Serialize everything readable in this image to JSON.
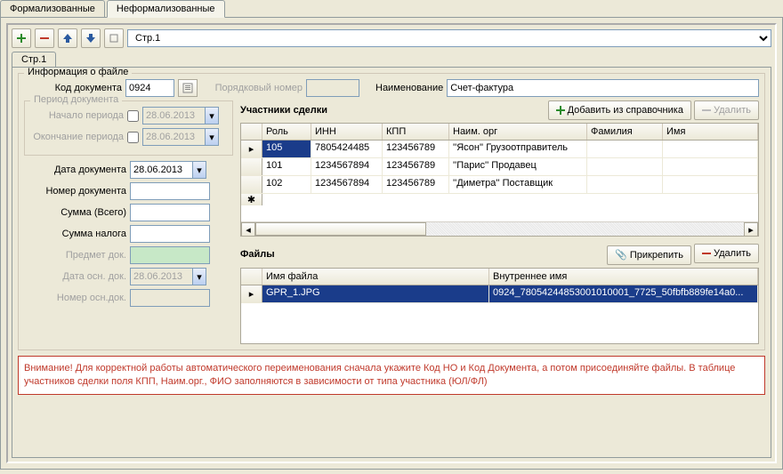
{
  "tabs": {
    "formal": "Формализованные",
    "informal": "Неформализованные"
  },
  "toolbar": {
    "page_label": "Стр.1"
  },
  "inner_tab": "Стр.1",
  "file_info_legend": "Информация о файле",
  "labels": {
    "doc_code": "Код документа",
    "ord_number": "Порядковый номер",
    "name": "Наименование",
    "period_legend": "Период документа",
    "period_start": "Начало периода",
    "period_end": "Окончание периода",
    "doc_date": "Дата документа",
    "doc_no": "Номер документа",
    "sum_total": "Сумма (Всего)",
    "sum_tax": "Сумма налога",
    "subject": "Предмет док.",
    "base_date": "Дата осн. док.",
    "base_no": "Номер осн.док."
  },
  "values": {
    "doc_code": "0924",
    "name": "Счет-фактура",
    "period_start": "28.06.2013",
    "period_end": "28.06.2013",
    "doc_date": "28.06.2013",
    "base_date": "28.06.2013"
  },
  "participants": {
    "title": "Участники сделки",
    "btn_add": "Добавить из справочника",
    "btn_del": "Удалить",
    "cols": {
      "role": "Роль",
      "inn": "ИНН",
      "kpp": "КПП",
      "org": "Наим. орг",
      "lastname": "Фамилия",
      "firstname": "Имя"
    },
    "rows": [
      {
        "role": "105",
        "inn": "7805424485",
        "kpp": "123456789",
        "org": "''Ясон'' Грузоотправитель",
        "lastname": "",
        "firstname": ""
      },
      {
        "role": "101",
        "inn": "1234567894",
        "kpp": "123456789",
        "org": "''Парис'' Продавец",
        "lastname": "",
        "firstname": ""
      },
      {
        "role": "102",
        "inn": "1234567894",
        "kpp": "123456789",
        "org": "''Диметра'' Поставщик",
        "lastname": "",
        "firstname": ""
      }
    ]
  },
  "files": {
    "title": "Файлы",
    "btn_attach": "Прикрепить",
    "btn_del": "Удалить",
    "cols": {
      "fname": "Имя файла",
      "iname": "Внутреннее имя"
    },
    "rows": [
      {
        "fname": "GPR_1.JPG",
        "iname": "0924_78054244853001010001_7725_50fbfb889fe14a0..."
      }
    ]
  },
  "warning": "Внимание! Для корректной работы автоматического переименования сначала укажите Код НО и Код Документа, а потом присоединяйте файлы. В таблице участников сделки поля КПП, Наим.орг., ФИО заполняются в зависимости от типа участника (ЮЛ/ФЛ)"
}
